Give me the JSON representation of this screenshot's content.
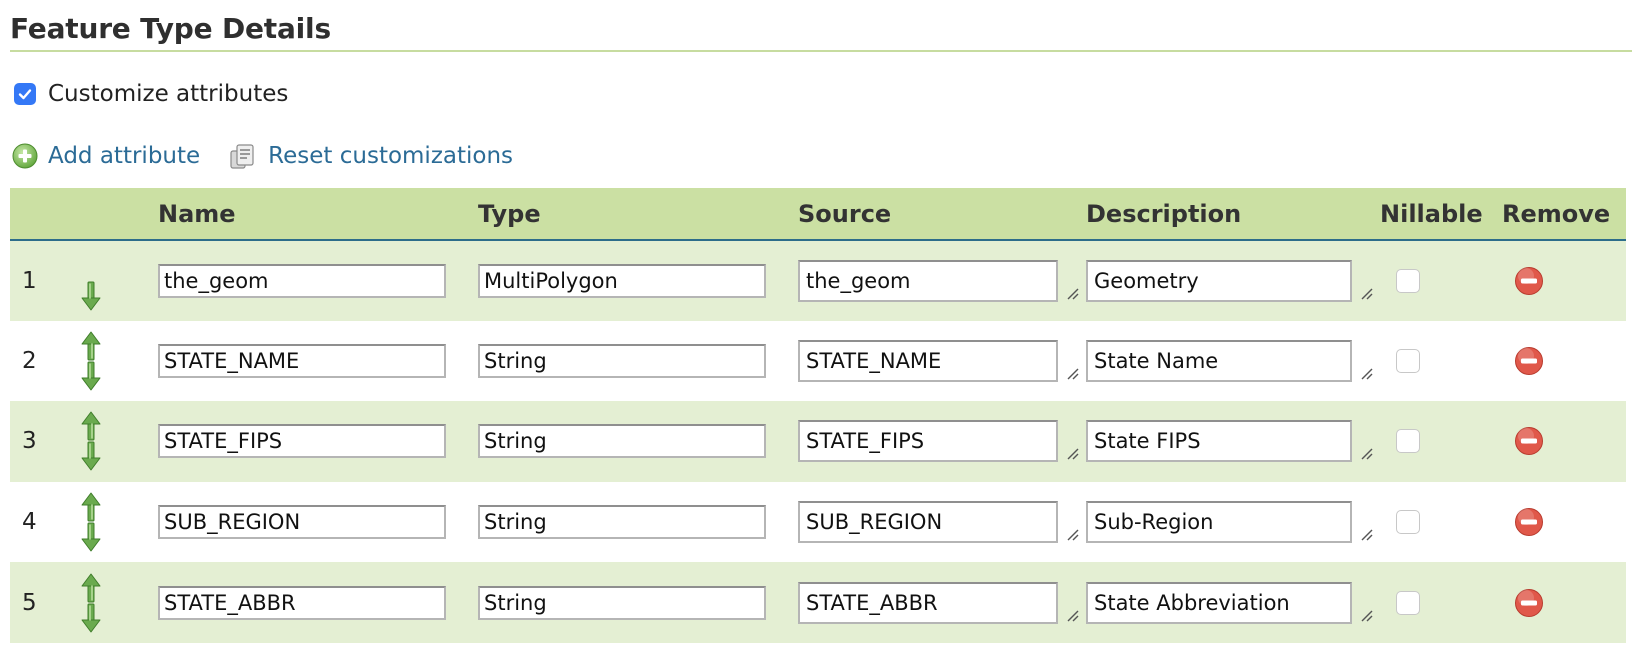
{
  "section": {
    "title": "Feature Type Details"
  },
  "customize": {
    "label": "Customize attributes",
    "checked": true
  },
  "actions": {
    "add_label": "Add attribute",
    "reset_label": "Reset customizations"
  },
  "table": {
    "headers": {
      "index": "",
      "move": "",
      "name": "Name",
      "type": "Type",
      "source": "Source",
      "description": "Description",
      "nillable": "Nillable",
      "remove": "Remove"
    },
    "rows": [
      {
        "index": "1",
        "name": "the_geom",
        "type": "MultiPolygon",
        "source": "the_geom",
        "description": "Geometry",
        "nillable": false,
        "can_move_up": false,
        "can_move_down": true
      },
      {
        "index": "2",
        "name": "STATE_NAME",
        "type": "String",
        "source": "STATE_NAME",
        "description": "State Name",
        "nillable": false,
        "can_move_up": true,
        "can_move_down": true
      },
      {
        "index": "3",
        "name": "STATE_FIPS",
        "type": "String",
        "source": "STATE_FIPS",
        "description": "State FIPS",
        "nillable": false,
        "can_move_up": true,
        "can_move_down": true
      },
      {
        "index": "4",
        "name": "SUB_REGION",
        "type": "String",
        "source": "SUB_REGION",
        "description": "Sub-Region",
        "nillable": false,
        "can_move_up": true,
        "can_move_down": true
      },
      {
        "index": "5",
        "name": "STATE_ABBR",
        "type": "String",
        "source": "STATE_ABBR",
        "description": "State Abbreviation",
        "nillable": false,
        "can_move_up": true,
        "can_move_down": true
      }
    ]
  },
  "colors": {
    "header_bg": "#cbe0a3",
    "row_odd_bg": "#e4efd3",
    "row_even_bg": "#ffffff",
    "link": "#2b6b96",
    "title_rule": "#c7dca0",
    "header_rule": "#2c6d8a",
    "checkbox_accent": "#3478f6",
    "remove_icon": "#e0584a",
    "arrow": "#6aaa4e"
  },
  "icons": {
    "add": "plus-circle-icon",
    "reset": "reset-icon",
    "up": "arrow-up-icon",
    "down": "arrow-down-icon",
    "remove": "remove-minus-circle-icon",
    "checkmark": "checkmark-icon"
  }
}
